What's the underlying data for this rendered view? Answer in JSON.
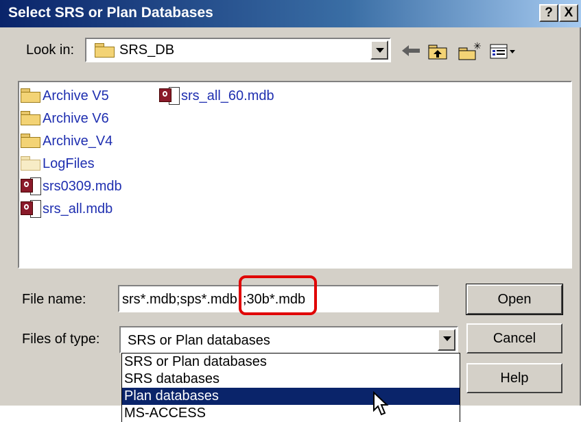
{
  "title": "Select SRS or Plan Databases",
  "title_buttons": {
    "help_label": "?",
    "close_label": "X"
  },
  "look_in": {
    "label": "Look in:",
    "value": "SRS_DB"
  },
  "toolbar": {
    "back_icon": "back-arrow-icon",
    "up_icon": "up-folder-icon",
    "new_folder_icon": "new-folder-icon",
    "view_icon": "view-menu-icon"
  },
  "files": [
    {
      "name": "Archive V5",
      "type": "folder"
    },
    {
      "name": "Archive V6",
      "type": "folder"
    },
    {
      "name": "Archive_V4",
      "type": "folder"
    },
    {
      "name": "LogFiles",
      "type": "folder"
    },
    {
      "name": "srs0309.mdb",
      "type": "mdb"
    },
    {
      "name": "srs_all.mdb",
      "type": "mdb"
    },
    {
      "name": "srs_all_60.mdb",
      "type": "mdb"
    }
  ],
  "file_name": {
    "label": "File name:",
    "value_main": "srs*.mdb;sps*.mdb",
    "value_highlight": ";30b*.mdb",
    "highlight_color": "#e00000"
  },
  "files_of_type": {
    "label": "Files of type:",
    "value": "SRS or Plan databases",
    "options": [
      "SRS or Plan databases",
      "SRS databases",
      "Plan databases",
      "MS-ACCESS"
    ],
    "selected_index": 2
  },
  "buttons": {
    "open": "Open",
    "cancel": "Cancel",
    "help": "Help"
  },
  "colors": {
    "titlebar": "#0a246a",
    "selection": "#0a246a",
    "face": "#d4d0c8"
  }
}
